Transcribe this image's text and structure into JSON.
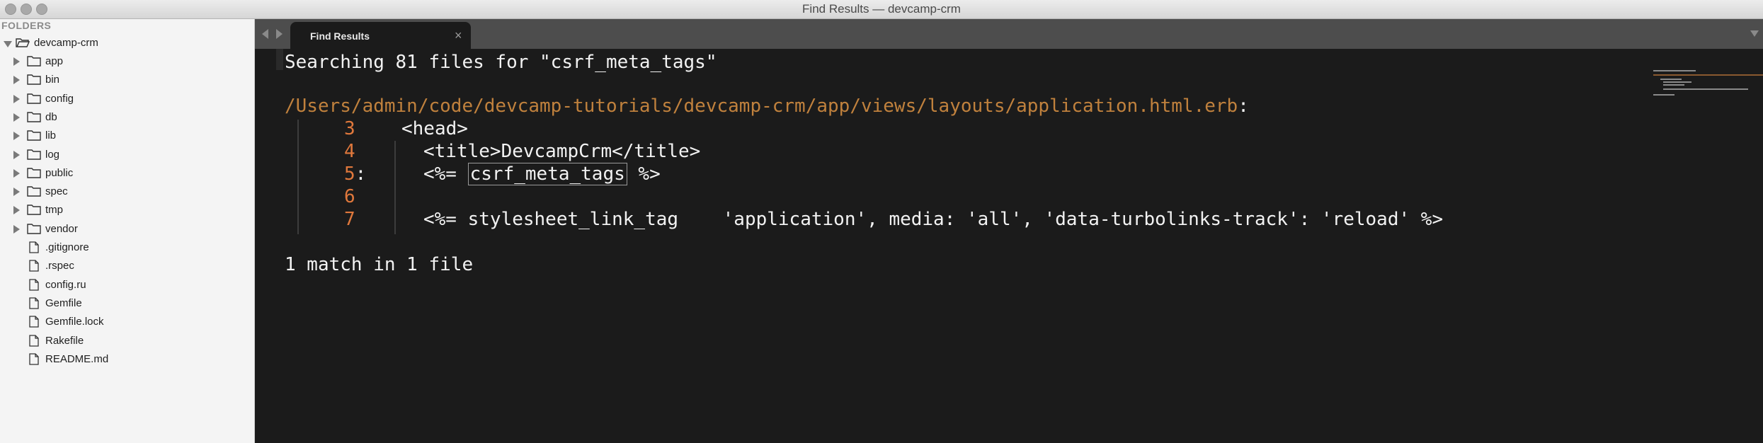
{
  "window": {
    "title": "Find Results — devcamp-crm"
  },
  "sidebar": {
    "header": "FOLDERS",
    "root": {
      "label": "devcamp-crm",
      "icon": "folder-open-icon"
    },
    "folders": [
      {
        "label": "app",
        "icon": "folder-icon"
      },
      {
        "label": "bin",
        "icon": "folder-icon"
      },
      {
        "label": "config",
        "icon": "folder-icon"
      },
      {
        "label": "db",
        "icon": "folder-icon"
      },
      {
        "label": "lib",
        "icon": "folder-icon"
      },
      {
        "label": "log",
        "icon": "folder-icon"
      },
      {
        "label": "public",
        "icon": "folder-icon"
      },
      {
        "label": "spec",
        "icon": "folder-icon"
      },
      {
        "label": "tmp",
        "icon": "folder-icon"
      },
      {
        "label": "vendor",
        "icon": "folder-icon"
      }
    ],
    "files": [
      {
        "label": ".gitignore",
        "icon": "file-icon"
      },
      {
        "label": ".rspec",
        "icon": "file-icon"
      },
      {
        "label": "config.ru",
        "icon": "file-icon"
      },
      {
        "label": "Gemfile",
        "icon": "file-icon"
      },
      {
        "label": "Gemfile.lock",
        "icon": "file-icon"
      },
      {
        "label": "Rakefile",
        "icon": "file-icon"
      },
      {
        "label": "README.md",
        "icon": "file-icon"
      }
    ]
  },
  "tabs": [
    {
      "label": "Find Results",
      "close": "×"
    }
  ],
  "results": {
    "summary": "Searching 81 files for \"csrf_meta_tags\"",
    "file_path": "/Users/admin/code/devcamp-tutorials/devcamp-crm/app/views/layouts/application.html.erb",
    "path_suffix": ":",
    "lines": [
      {
        "num": "3",
        "sep": "",
        "code": "<head>"
      },
      {
        "num": "4",
        "sep": "",
        "code": "<title>DevcampCrm</title>"
      },
      {
        "num": "5",
        "sep": ":",
        "code_pre": "<%= ",
        "match": "csrf_meta_tags",
        "code_post": " %>"
      },
      {
        "num": "6",
        "sep": "",
        "code": ""
      },
      {
        "num": "7",
        "sep": "",
        "code": "<%= stylesheet_link_tag    'application', media: 'all', 'data-turbolinks-track': 'reload' %>"
      }
    ],
    "footer": "1 match in 1 file"
  },
  "colors": {
    "path": "#c0813d",
    "line_number": "#e0783c",
    "editor_bg": "#1b1b1b",
    "sidebar_bg": "#f4f4f4"
  }
}
